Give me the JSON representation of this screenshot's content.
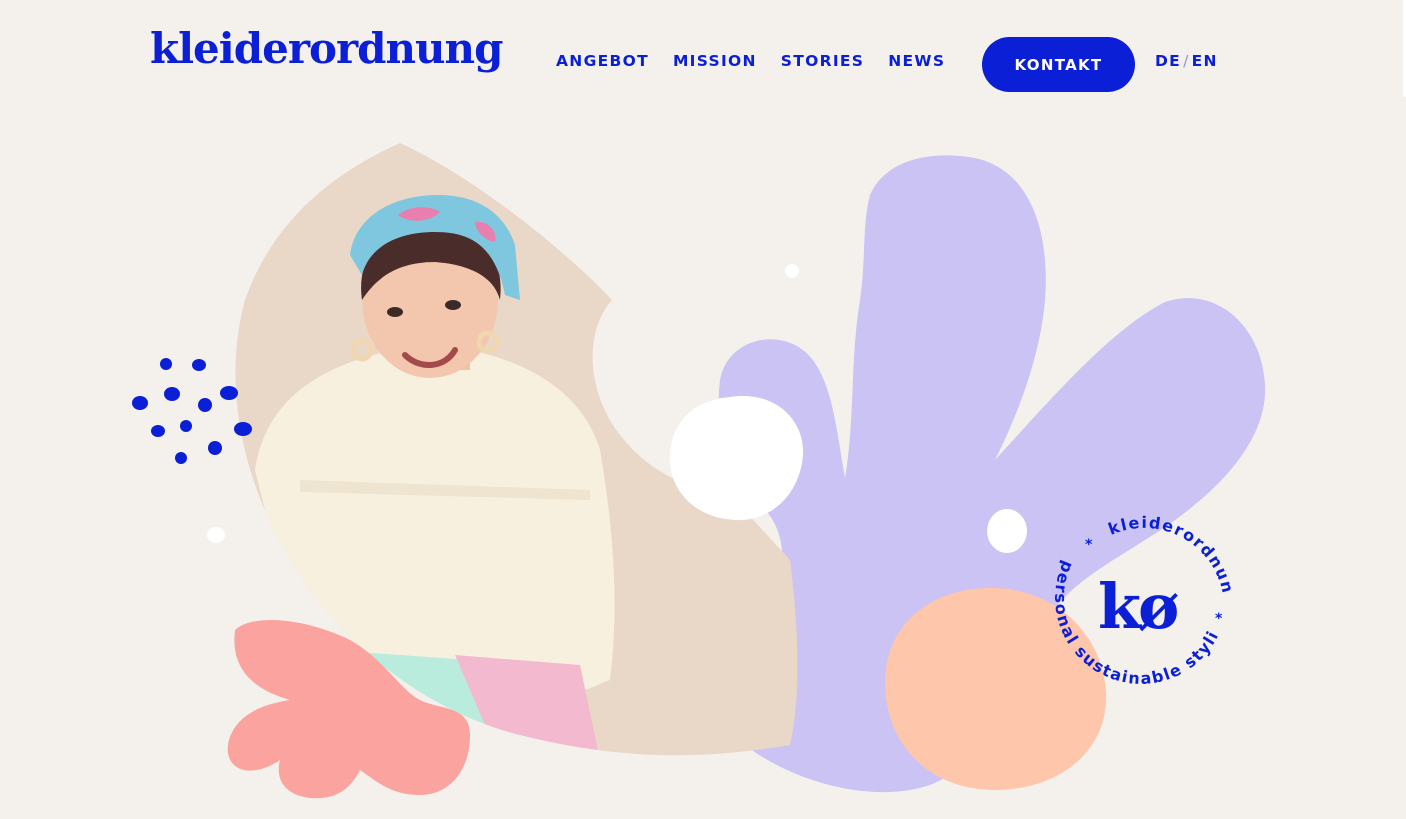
{
  "brand": {
    "logo_text": "kleiderordnung",
    "color": "#0a1fd6"
  },
  "nav": {
    "items": [
      {
        "label": "ANGEBOT"
      },
      {
        "label": "MISSION"
      },
      {
        "label": "STORIES"
      },
      {
        "label": "NEWS"
      }
    ],
    "contact_label": "KONTAKT",
    "lang_de": "DE",
    "lang_sep": "/",
    "lang_en": "EN"
  },
  "badge": {
    "top_text": "kleiderordnung",
    "bottom_text": "personal sustainable stylist",
    "star": "*",
    "monogram": "kø"
  },
  "colors": {
    "background": "#f4f1ec",
    "lavender": "#cbc3f4",
    "peach": "#fec6ab",
    "coral": "#fba39f",
    "beige": "#e9d8c7",
    "blue": "#0a1fd6"
  }
}
